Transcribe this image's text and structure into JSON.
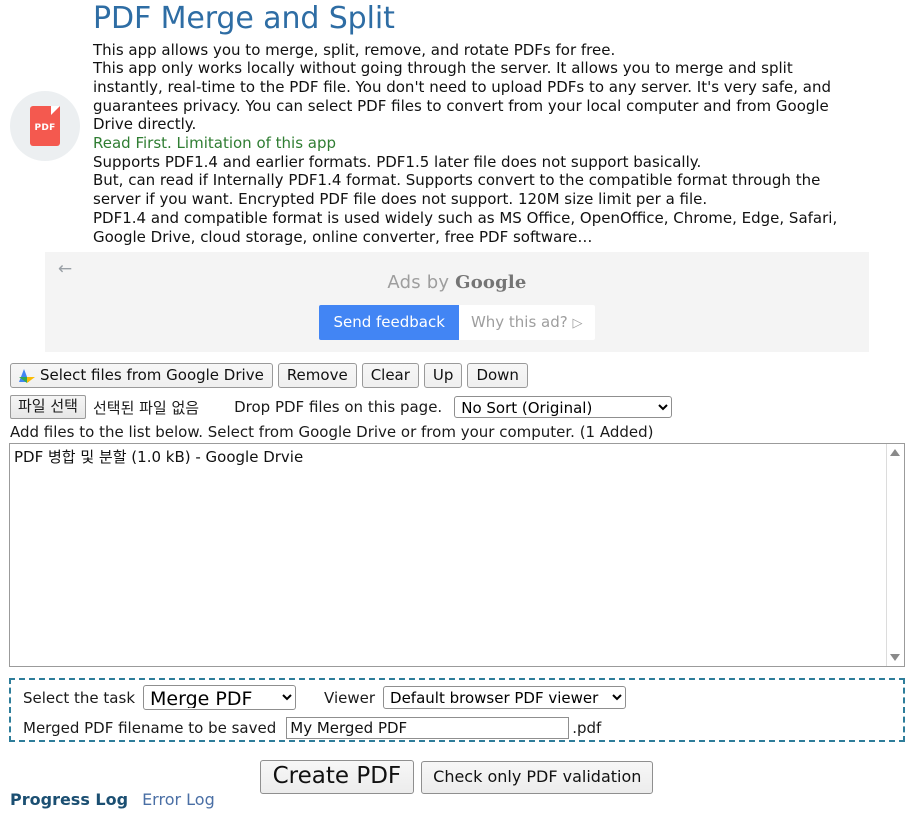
{
  "header": {
    "title": "PDF Merge and Split",
    "icon_label": "PDF",
    "intro_lines": [
      "This app allows you to merge, split, remove, and rotate PDFs for free.",
      "This app only works locally without going through the server. It allows you to merge and split",
      "instantly, real-time to the PDF file. You don't need to upload PDFs to any server. It's very safe, and",
      "guarantees privacy. You can select PDF files to convert from your local computer and from Google",
      "Drive directly."
    ],
    "read_first": "Read First. Limitation of this app",
    "limitation_lines": [
      "Supports PDF1.4 and earlier formats. PDF1.5 later file does not support basically.",
      "But, can read if Internally PDF1.4 format. Supports convert to the compatible format through the",
      "server if you want. Encrypted PDF file does not support. 120M size limit per a file.",
      "PDF1.4 and compatible format is used widely such as MS Office, OpenOffice, Chrome, Edge, Safari,",
      "Google Drive, cloud storage, online converter, free PDF software…"
    ]
  },
  "ad": {
    "back_arrow": "←",
    "ads_by": "Ads by ",
    "google": "Google",
    "send_feedback": "Send feedback",
    "why_this_ad": "Why this ad?",
    "why_this_ad_glyph": "▷"
  },
  "toolbar": {
    "gdrive_button": "Select files from Google Drive",
    "remove_button": "Remove",
    "clear_button": "Clear",
    "up_button": "Up",
    "down_button": "Down",
    "file_select_button": "파일 선택",
    "file_status": "선택된 파일 없음",
    "drop_hint": "Drop PDF files on this page.",
    "sort_selected": "No Sort (Original)",
    "sort_options": [
      "No Sort (Original)"
    ]
  },
  "list": {
    "hint": "Add files to the list below. Select from Google Drive or from your computer. (1 Added)",
    "items": [
      "PDF 병합 및 분할 (1.0 kB) - Google Drvie"
    ]
  },
  "task": {
    "select_task_label": "Select the task",
    "task_selected": "Merge PDF",
    "task_options": [
      "Merge PDF"
    ],
    "viewer_label": "Viewer",
    "viewer_selected": "Default browser PDF viewer",
    "viewer_options": [
      "Default browser PDF viewer"
    ],
    "filename_label": "Merged PDF filename to be saved",
    "filename_value": "My Merged PDF",
    "filename_extension": ".pdf"
  },
  "actions": {
    "create_pdf": "Create PDF",
    "check_validation": "Check only PDF validation"
  },
  "logs": {
    "progress_log": "Progress Log",
    "error_log": "Error Log"
  },
  "colors": {
    "title": "#2e6da4",
    "read_first_green": "#2f7d32",
    "dashed_border": "#2e7d9a",
    "ad_button_blue": "#4285f4",
    "progress_log_link": "#1b4f72"
  }
}
